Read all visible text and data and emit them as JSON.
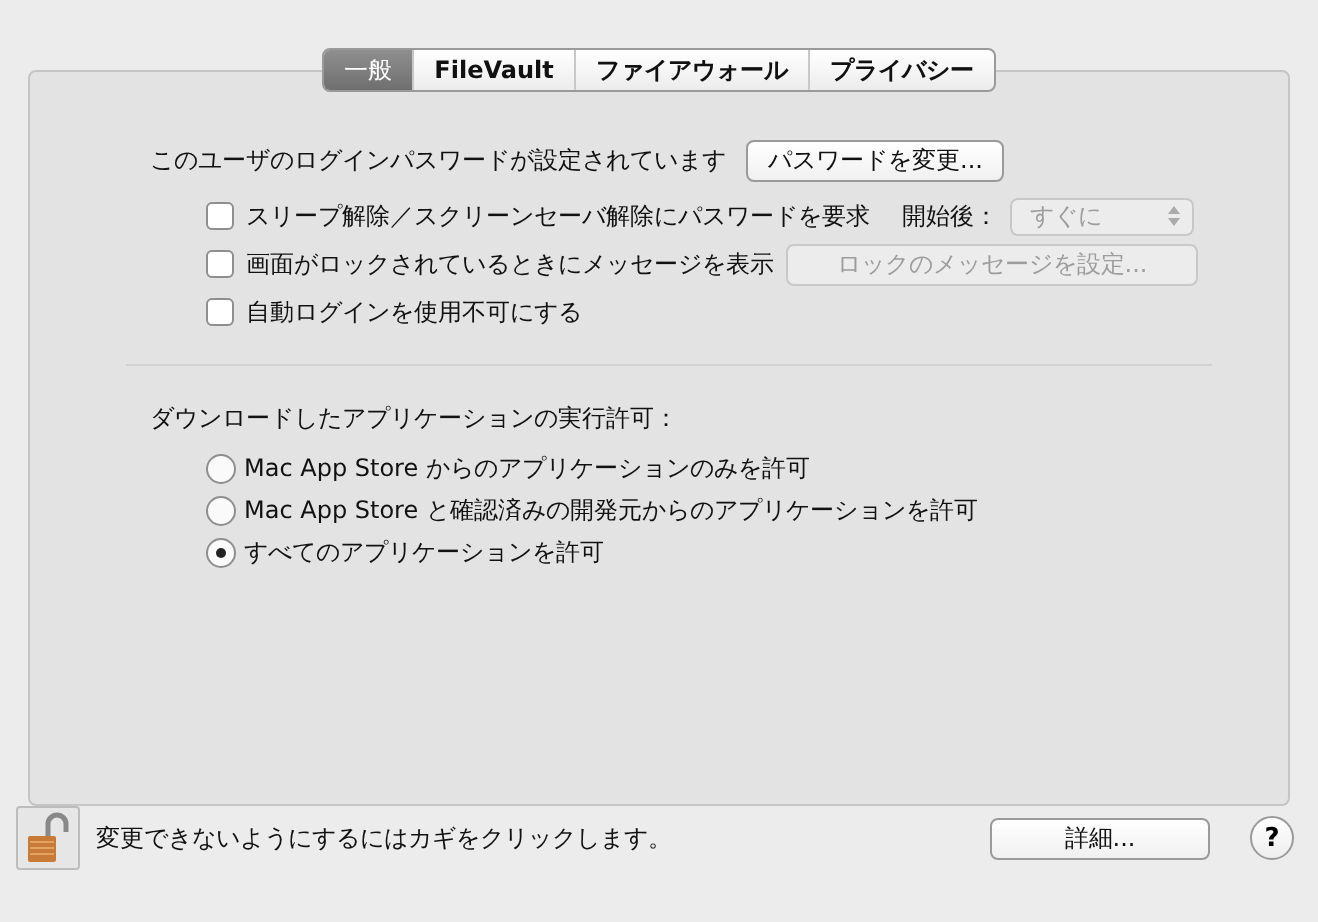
{
  "tabs": [
    {
      "label": "一般",
      "selected": true
    },
    {
      "label": "FileVault",
      "selected": false
    },
    {
      "label": "ファイアウォール",
      "selected": false
    },
    {
      "label": "プライバシー",
      "selected": false
    }
  ],
  "password": {
    "label": "このユーザのログインパスワードが設定されています",
    "button": "パスワードを変更..."
  },
  "options": [
    {
      "label": "スリープ解除／スクリーンセーバ解除にパスワードを要求",
      "checked": false,
      "delay_label": "開始後：",
      "delay_select": {
        "value": "すぐに",
        "disabled": true
      }
    },
    {
      "label": "画面がロックされているときにメッセージを表示",
      "checked": false,
      "button": {
        "label": "ロックのメッセージを設定...",
        "disabled": true
      }
    },
    {
      "label": "自動ログインを使用不可にする",
      "checked": false
    }
  ],
  "downloads": {
    "heading": "ダウンロードしたアプリケーションの実行許可：",
    "options": [
      {
        "label": "Mac App Store からのアプリケーションのみを許可",
        "selected": false
      },
      {
        "label": "Mac App Store と確認済みの開発元からのアプリケーションを許可",
        "selected": false
      },
      {
        "label": "すべてのアプリケーションを許可",
        "selected": true
      }
    ]
  },
  "footer": {
    "locked": false,
    "message": "変更できないようにするにはカギをクリックします。",
    "advanced_button": "詳細...",
    "help": "?"
  }
}
